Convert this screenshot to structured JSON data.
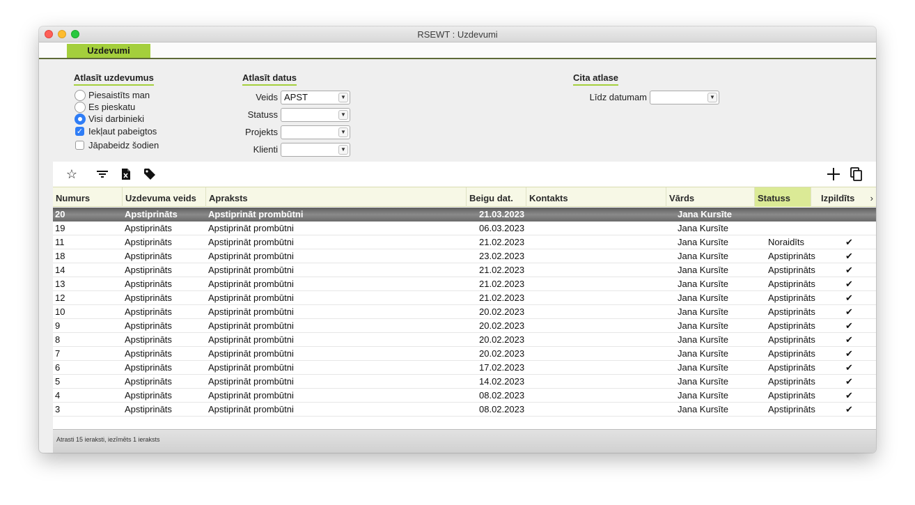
{
  "window": {
    "title": "RSEWT : Uzdevumi"
  },
  "tabs": [
    {
      "label": "Uzdevumi"
    }
  ],
  "filters": {
    "select_tasks": {
      "title": "Atlasīt uzdevumus",
      "options": [
        {
          "label": "Piesaistīts man",
          "type": "radio",
          "checked": false
        },
        {
          "label": "Es pieskatu",
          "type": "radio",
          "checked": false
        },
        {
          "label": "Visi darbinieki",
          "type": "radio",
          "checked": true
        },
        {
          "label": "Iekļaut pabeigtos",
          "type": "checkbox",
          "checked": true
        },
        {
          "label": "Jāpabeidz šodien",
          "type": "checkbox",
          "checked": false
        }
      ]
    },
    "select_data": {
      "title": "Atlasīt datus",
      "fields": [
        {
          "label": "Veids",
          "value": "APST"
        },
        {
          "label": "Statuss",
          "value": ""
        },
        {
          "label": "Projekts",
          "value": ""
        },
        {
          "label": "Klienti",
          "value": ""
        }
      ]
    },
    "other": {
      "title": "Cita atlase",
      "fields": [
        {
          "label": "Līdz datumam",
          "value": ""
        }
      ]
    }
  },
  "toolbar": {
    "icons": [
      "star-icon",
      "filter-icon",
      "excel-icon",
      "tag-icon",
      "plus-icon",
      "copy-icon"
    ]
  },
  "table": {
    "columns": [
      "Numurs",
      "Uzdevuma veids",
      "Apraksts",
      "Beigu dat.",
      "Kontakts",
      "Vārds",
      "Statuss",
      "Izpildīts"
    ],
    "sorted_column": "Statuss",
    "rows": [
      {
        "num": "20",
        "type": "Apstiprināts",
        "desc": "Apstiprināt prombūtni",
        "date": "21.03.2023",
        "contact": "",
        "name": "Jana Kursīte",
        "status": "",
        "done": "",
        "selected": true
      },
      {
        "num": "19",
        "type": "Apstiprināts",
        "desc": "Apstiprināt prombūtni",
        "date": "06.03.2023",
        "contact": "",
        "name": "Jana Kursīte",
        "status": "",
        "done": ""
      },
      {
        "num": "11",
        "type": "Apstiprināts",
        "desc": "Apstiprināt prombūtni",
        "date": "21.02.2023",
        "contact": "",
        "name": "Jana Kursīte",
        "status": "Noraidīts",
        "done": "✔"
      },
      {
        "num": "18",
        "type": "Apstiprināts",
        "desc": "Apstiprināt prombūtni",
        "date": "23.02.2023",
        "contact": "",
        "name": "Jana Kursīte",
        "status": "Apstiprināts",
        "done": "✔"
      },
      {
        "num": "14",
        "type": "Apstiprināts",
        "desc": "Apstiprināt prombūtni",
        "date": "21.02.2023",
        "contact": "",
        "name": "Jana Kursīte",
        "status": "Apstiprināts",
        "done": "✔"
      },
      {
        "num": "13",
        "type": "Apstiprināts",
        "desc": "Apstiprināt prombūtni",
        "date": "21.02.2023",
        "contact": "",
        "name": "Jana Kursīte",
        "status": "Apstiprināts",
        "done": "✔"
      },
      {
        "num": "12",
        "type": "Apstiprināts",
        "desc": "Apstiprināt prombūtni",
        "date": "21.02.2023",
        "contact": "",
        "name": "Jana Kursīte",
        "status": "Apstiprināts",
        "done": "✔"
      },
      {
        "num": "10",
        "type": "Apstiprināts",
        "desc": "Apstiprināt prombūtni",
        "date": "20.02.2023",
        "contact": "",
        "name": "Jana Kursīte",
        "status": "Apstiprināts",
        "done": "✔"
      },
      {
        "num": "9",
        "type": "Apstiprināts",
        "desc": "Apstiprināt prombūtni",
        "date": "20.02.2023",
        "contact": "",
        "name": "Jana Kursīte",
        "status": "Apstiprināts",
        "done": "✔"
      },
      {
        "num": "8",
        "type": "Apstiprināts",
        "desc": "Apstiprināt prombūtni",
        "date": "20.02.2023",
        "contact": "",
        "name": "Jana Kursīte",
        "status": "Apstiprināts",
        "done": "✔"
      },
      {
        "num": "7",
        "type": "Apstiprināts",
        "desc": "Apstiprināt prombūtni",
        "date": "20.02.2023",
        "contact": "",
        "name": "Jana Kursīte",
        "status": "Apstiprināts",
        "done": "✔"
      },
      {
        "num": "6",
        "type": "Apstiprināts",
        "desc": "Apstiprināt prombūtni",
        "date": "17.02.2023",
        "contact": "",
        "name": "Jana Kursīte",
        "status": "Apstiprināts",
        "done": "✔"
      },
      {
        "num": "5",
        "type": "Apstiprināts",
        "desc": "Apstiprināt prombūtni",
        "date": "14.02.2023",
        "contact": "",
        "name": "Jana Kursīte",
        "status": "Apstiprināts",
        "done": "✔"
      },
      {
        "num": "4",
        "type": "Apstiprināts",
        "desc": "Apstiprināt prombūtni",
        "date": "08.02.2023",
        "contact": "",
        "name": "Jana Kursīte",
        "status": "Apstiprināts",
        "done": "✔"
      },
      {
        "num": "3",
        "type": "Apstiprināts",
        "desc": "Apstiprināt prombūtni",
        "date": "08.02.2023",
        "contact": "",
        "name": "Jana Kursīte",
        "status": "Apstiprināts",
        "done": "✔"
      }
    ]
  },
  "status_bar": {
    "text": "Atrasti 15 ieraksti, iezīmēts 1 ieraksts"
  },
  "colors": {
    "accent": "#a4cf3c",
    "header_bg": "#f7f8e6",
    "sorted_header": "#dbea96",
    "selection": "#6a6a6a"
  }
}
